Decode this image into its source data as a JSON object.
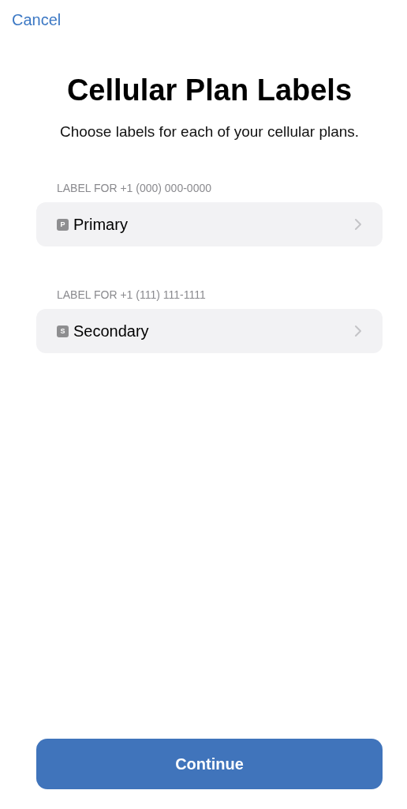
{
  "nav": {
    "cancel": "Cancel"
  },
  "title": "Cellular Plan Labels",
  "subtitle": "Choose labels for each of your cellular plans.",
  "plans": [
    {
      "header": "LABEL FOR +1 (000) 000-0000",
      "badge": "P",
      "label": "Primary"
    },
    {
      "header": "LABEL FOR +1 (111) 111-1111",
      "badge": "S",
      "label": "Secondary"
    }
  ],
  "button": "Continue"
}
